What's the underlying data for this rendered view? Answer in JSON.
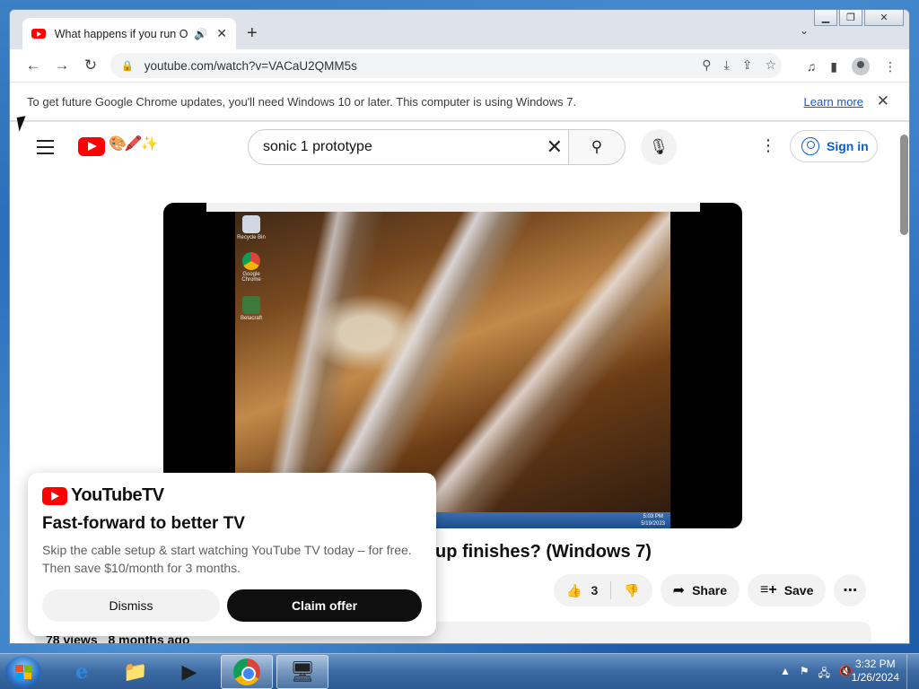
{
  "browser": {
    "tab_title": "What happens if you run OOBE",
    "url": "youtube.com/watch?v=VACaU2QMM5s",
    "infobar_text": "To get future Google Chrome updates, you'll need Windows 10 or later. This computer is using Windows 7.",
    "learn_more": "Learn more"
  },
  "youtube": {
    "search_value": "sonic 1 prototype",
    "sign_in": "Sign in",
    "video_title_visible": "up finishes? (Windows 7)",
    "likes": "3",
    "share_label": "Share",
    "save_label": "Save",
    "views": "78 views",
    "age": "8 months ago",
    "video_desktop_icons": [
      "Recycle Bin",
      "Google Chrome",
      "Betacraft"
    ],
    "video_clock": "5:03 PM",
    "video_date": "5/19/2023"
  },
  "promo": {
    "brand": "YouTubeTV",
    "heading": "Fast-forward to better TV",
    "body": "Skip the cable setup & start watching YouTube TV today – for free. Then save $10/month for 3 months.",
    "dismiss": "Dismiss",
    "claim": "Claim offer"
  },
  "taskbar": {
    "time": "3:32 PM",
    "date": "1/26/2024"
  },
  "colors": {
    "youtube_red": "#ff0000",
    "link_blue": "#065fd4",
    "chrome_link": "#1a56c8"
  }
}
